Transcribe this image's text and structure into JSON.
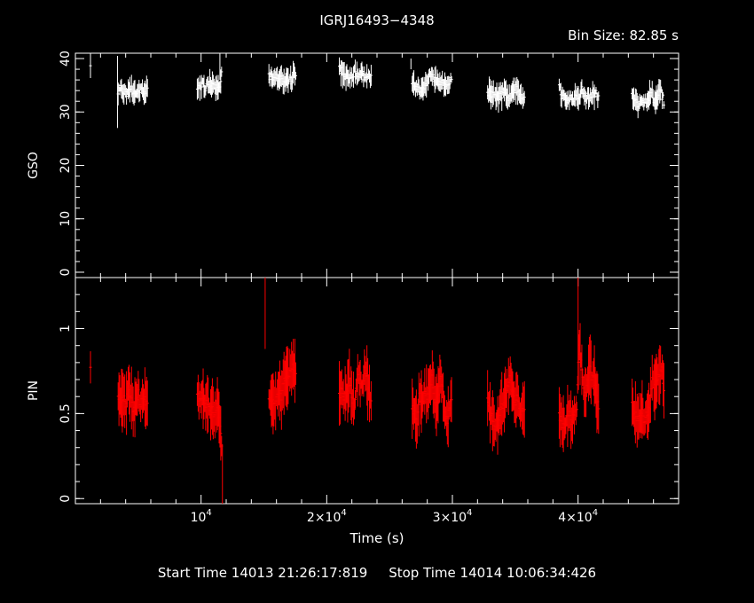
{
  "title": "IGRJ16493−4348",
  "bin_size_label": "Bin Size: 82.85 s",
  "footer": {
    "start_label": "Start Time 14013 21:26:17:819",
    "stop_label": "Stop Time 14014 10:06:34:426"
  },
  "colors": {
    "background": "#000000",
    "axes": "#ffffff",
    "gso": "#ffffff",
    "pin": "#ff0000"
  },
  "chart_data": [
    {
      "type": "scatter",
      "panel": "top",
      "ylabel": "GSO",
      "xlabel": "",
      "xlim": [
        0,
        48000
      ],
      "ylim": [
        -1,
        41
      ],
      "yticks": [
        0,
        10,
        20,
        30,
        40
      ],
      "grid": false,
      "segments": [
        {
          "x": [
            1200
          ],
          "y": [
            38
          ]
        },
        {
          "x": [
            3400,
            3600,
            3800,
            4000,
            4200,
            4400,
            4600,
            4800,
            5000,
            5200,
            5400,
            5600,
            5800
          ],
          "y": [
            34,
            34.5,
            34,
            33.5,
            34,
            34.5,
            34,
            33.5,
            34,
            34.5,
            34,
            33.5,
            36
          ]
        },
        {
          "x": [
            9700,
            9900,
            10100,
            10300,
            10500,
            10700,
            10900,
            11100,
            11300,
            11500,
            11700
          ],
          "y": [
            34.5,
            35,
            35,
            34.5,
            35,
            35.5,
            35,
            34.5,
            34.5,
            35,
            38
          ]
        },
        {
          "x": [
            15400,
            15600,
            15800,
            16000,
            16200,
            16400,
            16600,
            16800,
            17000,
            17200,
            17400,
            17600
          ],
          "y": [
            37,
            36.5,
            36,
            37,
            36.5,
            36,
            36,
            36.5,
            36.5,
            36,
            37,
            37
          ]
        },
        {
          "x": [
            21000,
            21200,
            21400,
            21600,
            21800,
            22000,
            22200,
            22400,
            22600,
            22800,
            23000,
            23200,
            23400,
            23600
          ],
          "y": [
            38,
            37.5,
            37,
            37,
            36.5,
            37,
            37.5,
            37,
            36.5,
            37,
            36.5,
            37,
            36.5,
            36
          ]
        },
        {
          "x": [
            26800,
            27000,
            27200,
            27400,
            27600,
            27800,
            28000,
            28200,
            28400,
            28600,
            28800,
            29000,
            29200,
            29400,
            29600,
            29800,
            30000
          ],
          "y": [
            36,
            35,
            34.5,
            34,
            34.5,
            35,
            36,
            37,
            36.5,
            36,
            36,
            35.5,
            36,
            35,
            35,
            35.5,
            36
          ]
        },
        {
          "x": [
            32800,
            33000,
            33200,
            33400,
            33600,
            33800,
            34000,
            34200,
            34400,
            34600,
            34800,
            35000,
            35200,
            35400,
            35600,
            35800
          ],
          "y": [
            34,
            33.5,
            33.5,
            33,
            32.5,
            33,
            33.5,
            34,
            33,
            33,
            34,
            34.5,
            34,
            33.5,
            33,
            33.5
          ]
        },
        {
          "x": [
            38500,
            38700,
            38900,
            39100,
            39300,
            39500,
            39700,
            39900,
            40100,
            40300,
            40500,
            40700,
            40900,
            41100,
            41300,
            41500,
            41700
          ],
          "y": [
            35,
            33,
            32.5,
            32.5,
            33,
            33,
            32.5,
            32.5,
            33,
            34,
            33,
            33,
            32.5,
            33.5,
            33.5,
            33,
            32.5
          ]
        },
        {
          "x": [
            44300,
            44500,
            44700,
            44900,
            45100,
            45300,
            45500,
            45700,
            45900,
            46100,
            46300,
            46500,
            46700,
            46900
          ],
          "y": [
            33,
            32,
            31.5,
            32,
            32.5,
            32,
            32.5,
            33,
            33.5,
            32,
            32.5,
            34,
            33,
            31
          ]
        }
      ],
      "spikes": [
        {
          "x": 3350,
          "ylo": 27,
          "yhi": 40.5
        },
        {
          "x": 11500,
          "ylo": 36,
          "yhi": 41
        },
        {
          "x": 26700,
          "ylo": 38,
          "yhi": 40
        }
      ]
    },
    {
      "type": "scatter",
      "panel": "bottom",
      "ylabel": "PIN",
      "xlabel": "Time (s)",
      "xlim": [
        0,
        48000
      ],
      "ylim": [
        -0.03,
        1.3
      ],
      "yticks": [
        0,
        0.5,
        1
      ],
      "ytick_labels": [
        "0",
        "0.5",
        "1"
      ],
      "xticks": [
        10000,
        20000,
        30000,
        40000
      ],
      "xtick_labels": [
        {
          "mantissa": "",
          "exp": "4"
        },
        {
          "mantissa": "2×",
          "exp": "4"
        },
        {
          "mantissa": "3×",
          "exp": "4"
        },
        {
          "mantissa": "4×",
          "exp": "4"
        }
      ],
      "grid": false,
      "segments": [
        {
          "x": [
            1200
          ],
          "y": [
            0.75
          ]
        },
        {
          "x": [
            3400,
            3600,
            3800,
            4000,
            4200,
            4400,
            4600,
            4800,
            5000,
            5200,
            5400,
            5600,
            5800
          ],
          "y": [
            0.62,
            0.58,
            0.6,
            0.55,
            0.65,
            0.6,
            0.52,
            0.58,
            0.62,
            0.55,
            0.6,
            0.57,
            0.58
          ]
        },
        {
          "x": [
            9700,
            9900,
            10100,
            10300,
            10500,
            10700,
            10900,
            11100,
            11300,
            11500,
            11700
          ],
          "y": [
            0.62,
            0.58,
            0.6,
            0.55,
            0.57,
            0.5,
            0.52,
            0.48,
            0.55,
            0.45,
            0.22
          ]
        },
        {
          "x": [
            15400,
            15600,
            15800,
            16000,
            16200,
            16400,
            16600,
            16800,
            17000,
            17200,
            17400,
            17600
          ],
          "y": [
            0.58,
            0.6,
            0.55,
            0.62,
            0.65,
            0.6,
            0.68,
            0.7,
            0.72,
            0.75,
            0.78,
            0.7
          ]
        },
        {
          "x": [
            21000,
            21200,
            21400,
            21600,
            21800,
            22000,
            22200,
            22400,
            22600,
            22800,
            23000,
            23200,
            23400,
            23600
          ],
          "y": [
            0.6,
            0.65,
            0.58,
            0.62,
            0.7,
            0.6,
            0.55,
            0.68,
            0.72,
            0.65,
            0.75,
            0.7,
            0.6,
            0.58
          ]
        },
        {
          "x": [
            26800,
            27000,
            27200,
            27400,
            27600,
            27800,
            28000,
            28200,
            28400,
            28600,
            28800,
            29000,
            29200,
            29400,
            29600,
            29800,
            30000
          ],
          "y": [
            0.55,
            0.5,
            0.45,
            0.6,
            0.55,
            0.62,
            0.58,
            0.65,
            0.7,
            0.6,
            0.55,
            0.72,
            0.65,
            0.5,
            0.45,
            0.55,
            0.6
          ]
        },
        {
          "x": [
            32800,
            33000,
            33200,
            33400,
            33600,
            33800,
            34000,
            34200,
            34400,
            34600,
            34800,
            35000,
            35200,
            35400,
            35600,
            35800
          ],
          "y": [
            0.6,
            0.52,
            0.48,
            0.42,
            0.45,
            0.5,
            0.55,
            0.6,
            0.65,
            0.7,
            0.62,
            0.55,
            0.6,
            0.5,
            0.55,
            0.52
          ]
        },
        {
          "x": [
            38500,
            38700,
            38900,
            39100,
            39300,
            39500,
            39700,
            39900,
            40100,
            40300,
            40500,
            40700,
            40900,
            41100,
            41300,
            41500,
            41700
          ],
          "y": [
            0.5,
            0.45,
            0.42,
            0.48,
            0.52,
            0.45,
            0.48,
            0.55,
            0.9,
            0.75,
            0.6,
            0.65,
            0.78,
            0.72,
            0.7,
            0.58,
            0.5
          ]
        },
        {
          "x": [
            44300,
            44500,
            44700,
            44900,
            45100,
            45300,
            45500,
            45700,
            45900,
            46100,
            46300,
            46500,
            46700,
            46900
          ],
          "y": [
            0.55,
            0.5,
            0.45,
            0.48,
            0.52,
            0.45,
            0.5,
            0.55,
            0.72,
            0.65,
            0.7,
            0.75,
            0.78,
            0.55
          ]
        }
      ],
      "spikes": [
        {
          "x": 15100,
          "ylo": 0.88,
          "yhi": 1.3
        },
        {
          "x": 11700,
          "ylo": -0.03,
          "yhi": 0.32
        },
        {
          "x": 40000,
          "ylo": 0.7,
          "yhi": 1.3
        }
      ]
    }
  ]
}
